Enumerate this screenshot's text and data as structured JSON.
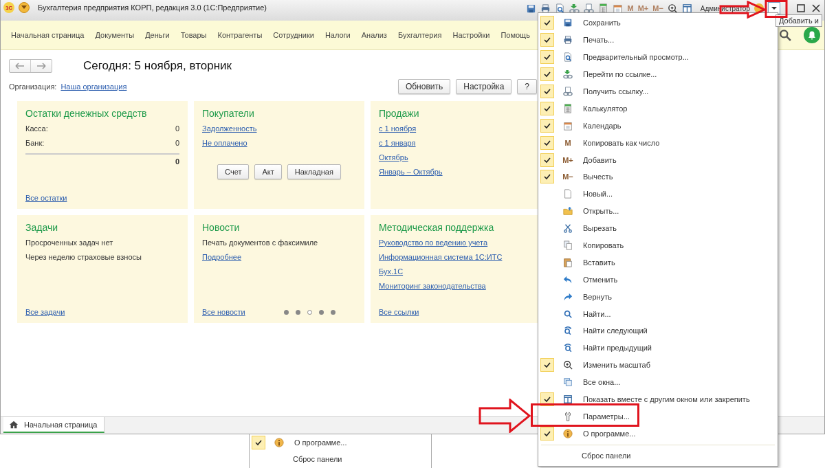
{
  "window": {
    "logo": "1С",
    "title": "Бухгалтерия предприятия КОРП, редакция 3.0  (1С:Предприятие)",
    "toolbar_glyphs": [
      "M",
      "M+",
      "M−"
    ],
    "user": "Администратор"
  },
  "tooltip": "Добавить и",
  "sections": [
    "Начальная страница",
    "Документы",
    "Деньги",
    "Товары",
    "Контрагенты",
    "Сотрудники",
    "Налоги",
    "Анализ",
    "Бухгалтерия",
    "Настройки",
    "Помощь"
  ],
  "page": {
    "title": "Сегодня: 5 ноября, вторник",
    "org_label": "Организация:",
    "org_link": "Наша организация",
    "buttons": [
      "Обновить",
      "Настройка",
      "?"
    ]
  },
  "cards": [
    {
      "title": "Остатки денежных средств",
      "rows": [
        {
          "kind": "amount",
          "label": "Касса:",
          "value": "0"
        },
        {
          "kind": "amount",
          "label": "Банк:",
          "value": "0"
        },
        {
          "kind": "total",
          "value": "0"
        }
      ],
      "footer": "Все остатки"
    },
    {
      "title": "Покупатели",
      "rows": [
        {
          "kind": "link",
          "text": "Задолженность"
        },
        {
          "kind": "link",
          "text": "Не оплачено"
        },
        {
          "kind": "buttons",
          "items": [
            "Счет",
            "Акт",
            "Накладная"
          ]
        }
      ]
    },
    {
      "title": "Продажи",
      "rows": [
        {
          "kind": "link",
          "text": "с 1 ноября"
        },
        {
          "kind": "link",
          "text": "с 1 января"
        },
        {
          "kind": "link",
          "text": "Октябрь"
        },
        {
          "kind": "link",
          "text": "Январь – Октябрь"
        }
      ]
    },
    {
      "title": "Задачи",
      "rows": [
        {
          "kind": "text",
          "text": "Просроченных задач нет"
        },
        {
          "kind": "text",
          "text": "Через неделю страховые взносы"
        }
      ],
      "footer": "Все задачи"
    },
    {
      "title": "Новости",
      "rows": [
        {
          "kind": "text",
          "text": "Печать документов с факсимиле"
        },
        {
          "kind": "link",
          "text": "Подробнее"
        }
      ],
      "footer": "Все новости",
      "dots": [
        {
          "selected": false
        },
        {
          "selected": false
        },
        {
          "selected": true
        },
        {
          "selected": false
        },
        {
          "selected": false
        }
      ]
    },
    {
      "title": "Методическая поддержка",
      "rows": [
        {
          "kind": "link",
          "text": "Руководство по ведению учета"
        },
        {
          "kind": "link",
          "text": "Информационная система 1С:ИТС"
        },
        {
          "kind": "link",
          "text": "Бух.1С"
        },
        {
          "kind": "link",
          "text": "Мониторинг законодательства"
        }
      ],
      "footer": "Все ссылки"
    }
  ],
  "tabs": [
    {
      "label": "Начальная страница",
      "selected": true
    }
  ],
  "menu": {
    "items": [
      {
        "label": "Сохранить",
        "checked": true
      },
      {
        "label": "Печать...",
        "checked": true
      },
      {
        "label": "Предварительный просмотр...",
        "checked": true
      },
      {
        "label": "Перейти по ссылке...",
        "checked": true
      },
      {
        "label": "Получить ссылку...",
        "checked": true
      },
      {
        "label": "Калькулятор",
        "checked": true
      },
      {
        "label": "Календарь",
        "checked": true
      },
      {
        "label": "Копировать как число",
        "checked": true,
        "glyph": "M"
      },
      {
        "label": "Добавить",
        "checked": true,
        "glyph": "M+"
      },
      {
        "label": "Вычесть",
        "checked": true,
        "glyph": "M−"
      },
      {
        "label": "Новый...",
        "checked": false
      },
      {
        "label": "Открыть...",
        "checked": false
      },
      {
        "label": "Вырезать",
        "checked": false
      },
      {
        "label": "Копировать",
        "checked": false
      },
      {
        "label": "Вставить",
        "checked": false
      },
      {
        "label": "Отменить",
        "checked": false
      },
      {
        "label": "Вернуть",
        "checked": false
      },
      {
        "label": "Найти...",
        "checked": false
      },
      {
        "label": "Найти следующий",
        "checked": false
      },
      {
        "label": "Найти предыдущий",
        "checked": false
      },
      {
        "label": "Изменить масштаб",
        "checked": true
      },
      {
        "label": "Все окна...",
        "checked": false
      },
      {
        "label": "Показать вместе с другим окном или закрепить",
        "checked": true
      },
      {
        "label": "Параметры...",
        "checked": false
      },
      {
        "label": "О программе...",
        "checked": true
      }
    ],
    "reset": "Сброс панели"
  },
  "fragment": {
    "items": [
      {
        "label": "О программе...",
        "checked": true
      }
    ],
    "reset": "Сброс панели"
  }
}
